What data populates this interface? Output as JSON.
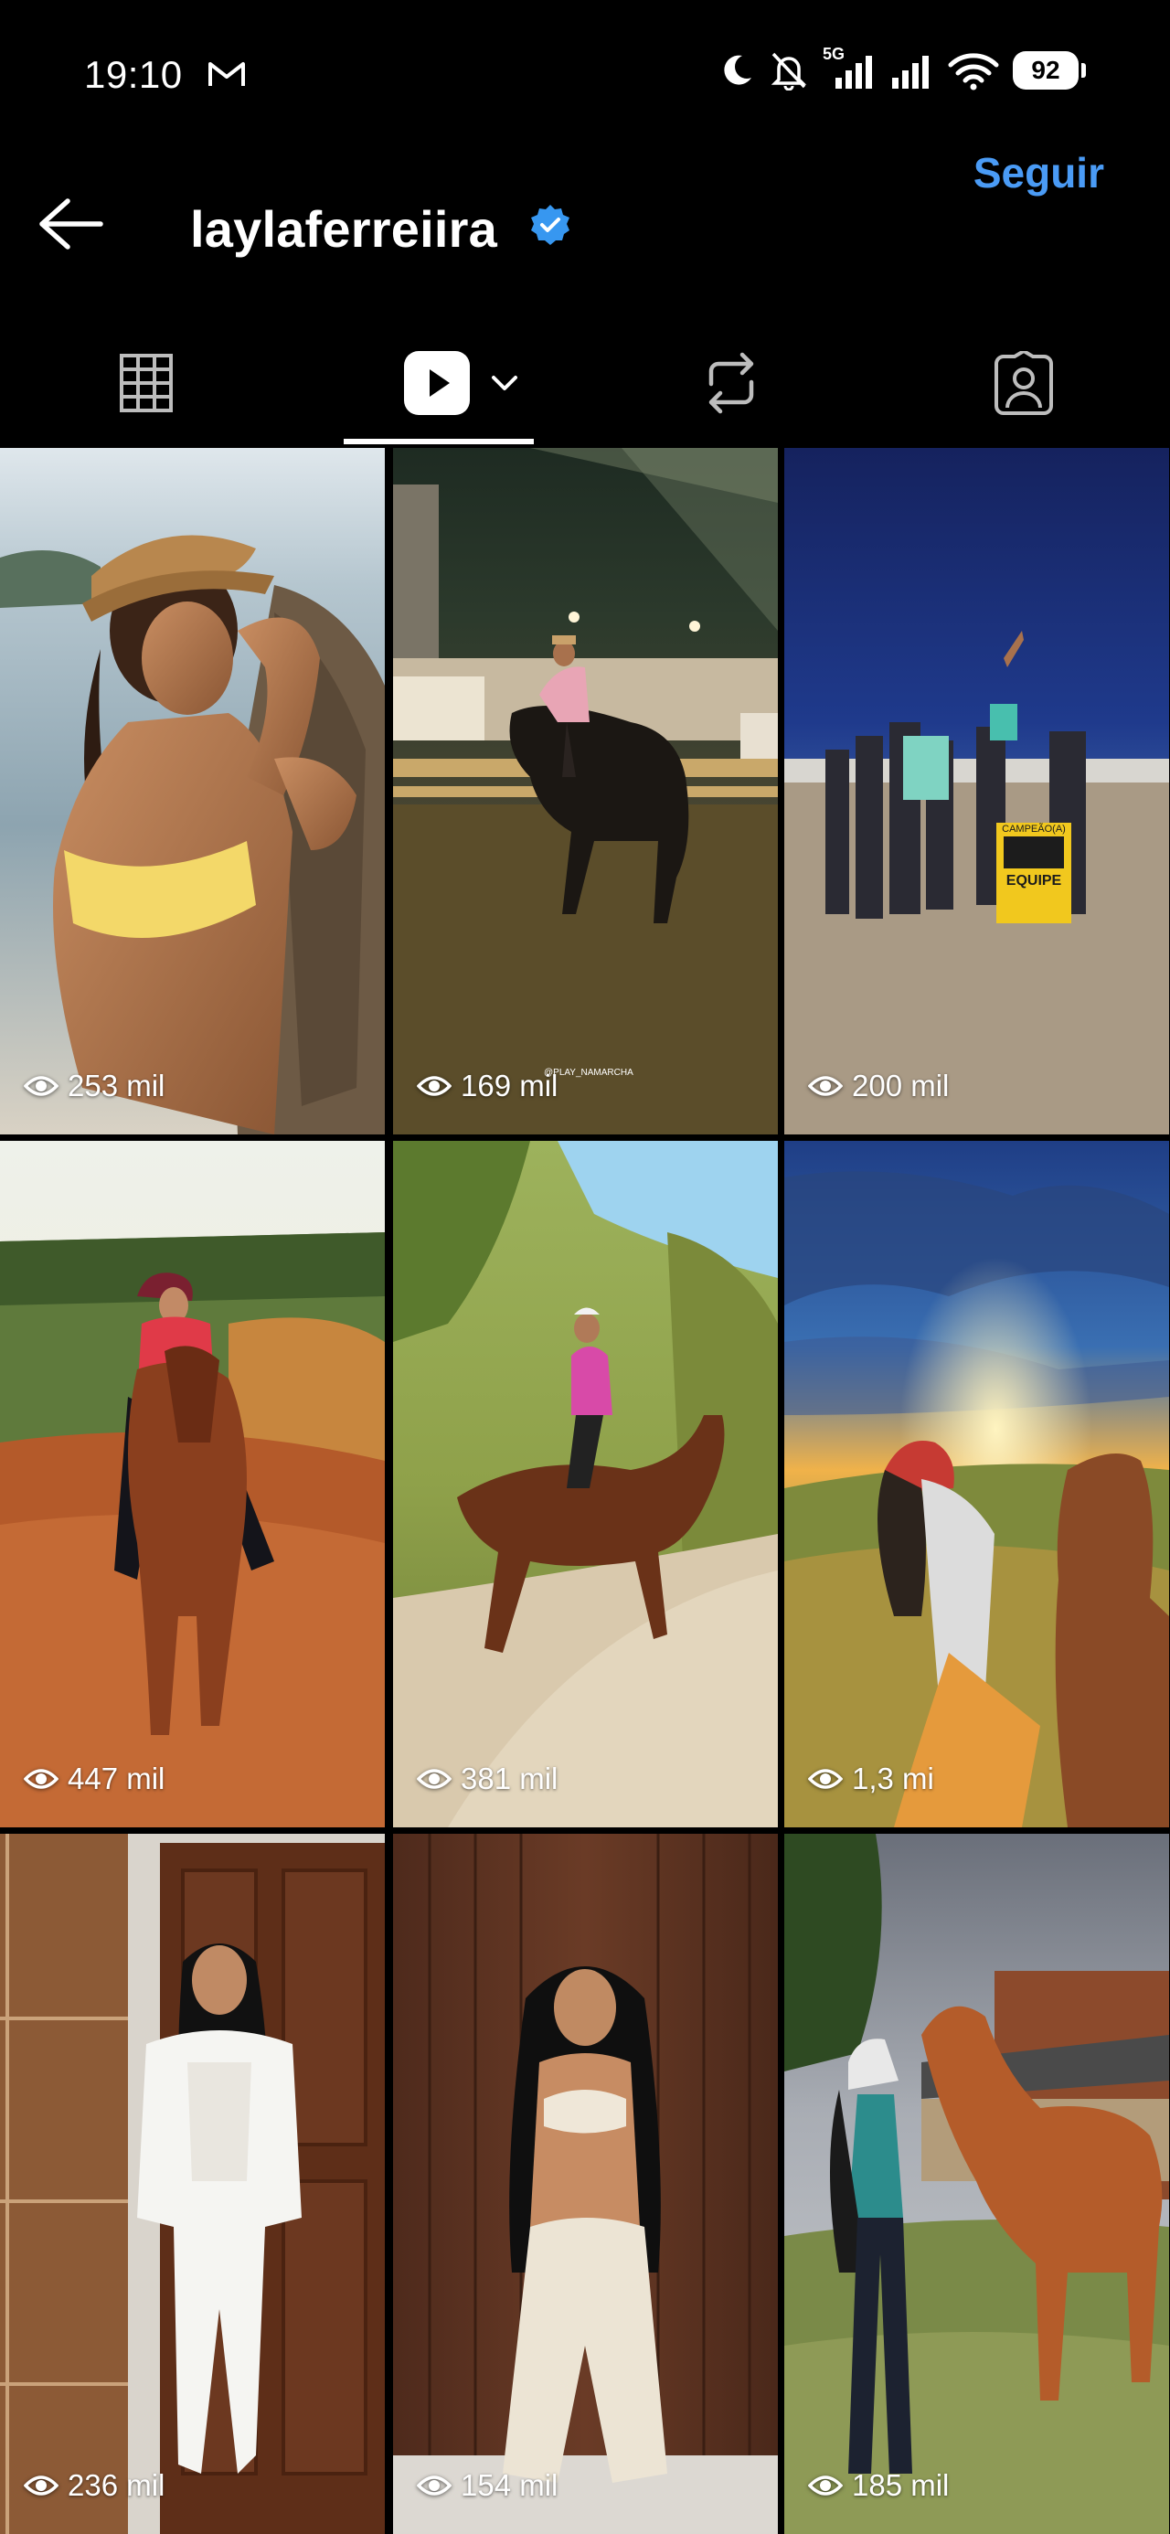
{
  "status_bar": {
    "time": "19:10",
    "network": "5G",
    "battery": "92"
  },
  "header": {
    "username": "laylaferreiira",
    "follow_label": "Seguir"
  },
  "tabs": [
    {
      "name": "grid"
    },
    {
      "name": "reels",
      "active": true
    },
    {
      "name": "reposts"
    },
    {
      "name": "tagged"
    }
  ],
  "reels": [
    {
      "views": "253 mil"
    },
    {
      "views": "169 mil",
      "watermark": "@PLAY_NAMARCHA"
    },
    {
      "views": "200 mil",
      "sign_title": "CAMPEÃO(A)",
      "sign_brand": "EQUIPE"
    },
    {
      "views": "447 mil"
    },
    {
      "views": "381 mil"
    },
    {
      "views": "1,3 mi"
    },
    {
      "views": "236 mil"
    },
    {
      "views": "154 mil"
    },
    {
      "views": "185 mil"
    }
  ],
  "colors": {
    "background": "#000000",
    "accent": "#4a9bf5",
    "verified": "#3797f0"
  }
}
